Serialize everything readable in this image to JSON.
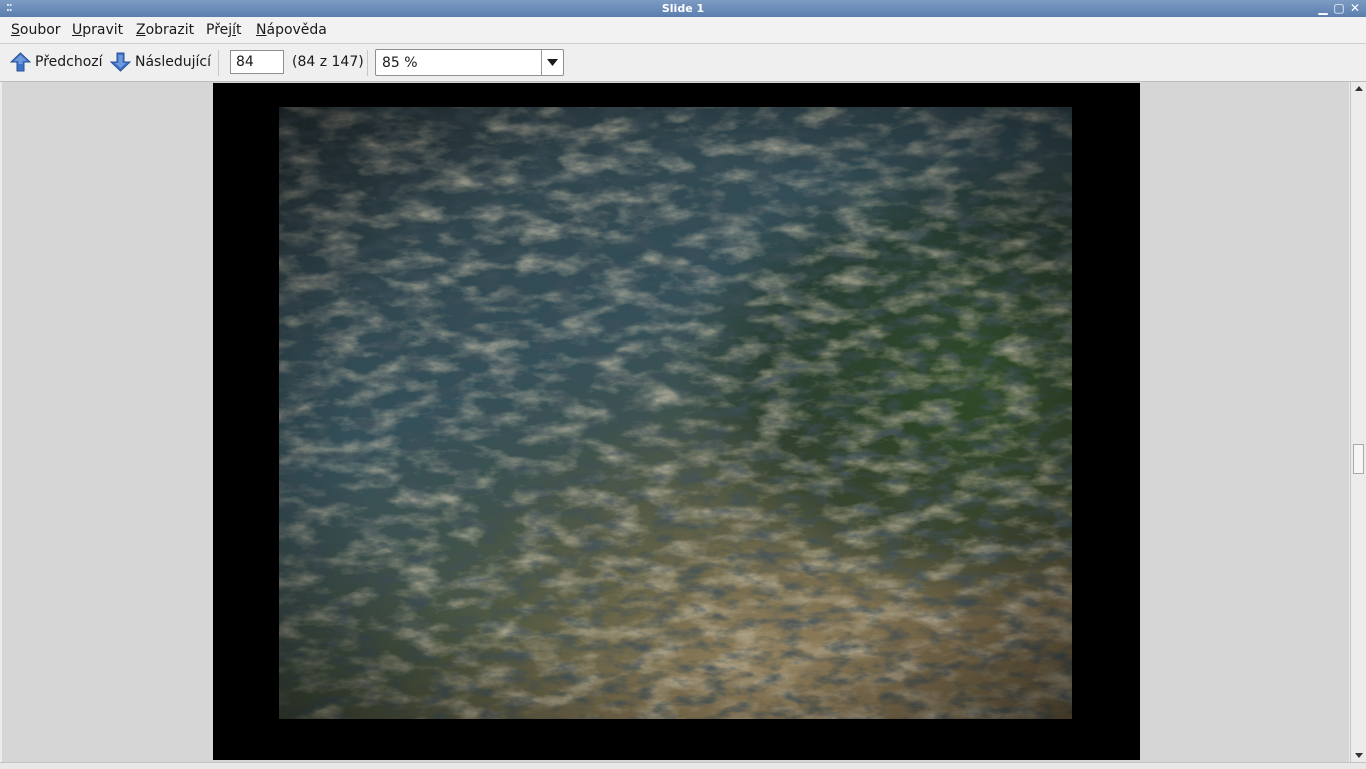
{
  "window": {
    "title": "Slide 1"
  },
  "menu": {
    "file": {
      "mnemonic": "S",
      "rest": "oubor"
    },
    "edit": {
      "mnemonic": "U",
      "rest": "pravit"
    },
    "view": {
      "mnemonic": "Z",
      "rest": "obrazit"
    },
    "go": {
      "pre": "Přej",
      "mnemonic": "í",
      "rest": "t"
    },
    "help": {
      "mnemonic": "N",
      "rest": "ápověda"
    }
  },
  "toolbar": {
    "previous_label": "Předchozí",
    "next_label": "Následující",
    "page_value": "84",
    "page_count": "(84 z 147)",
    "zoom_value": "85 %"
  },
  "icons": {
    "previous": "arrow-up-icon",
    "next": "arrow-down-icon",
    "zoom_dropdown": "chevron-down-icon"
  },
  "colors": {
    "titlebar": "#5a7eae",
    "arrow_icon": "#3d73c6",
    "slide_background": "#000000",
    "viewer_background": "#d6d6d6"
  },
  "scroll": {
    "position_fraction": 0.56
  }
}
